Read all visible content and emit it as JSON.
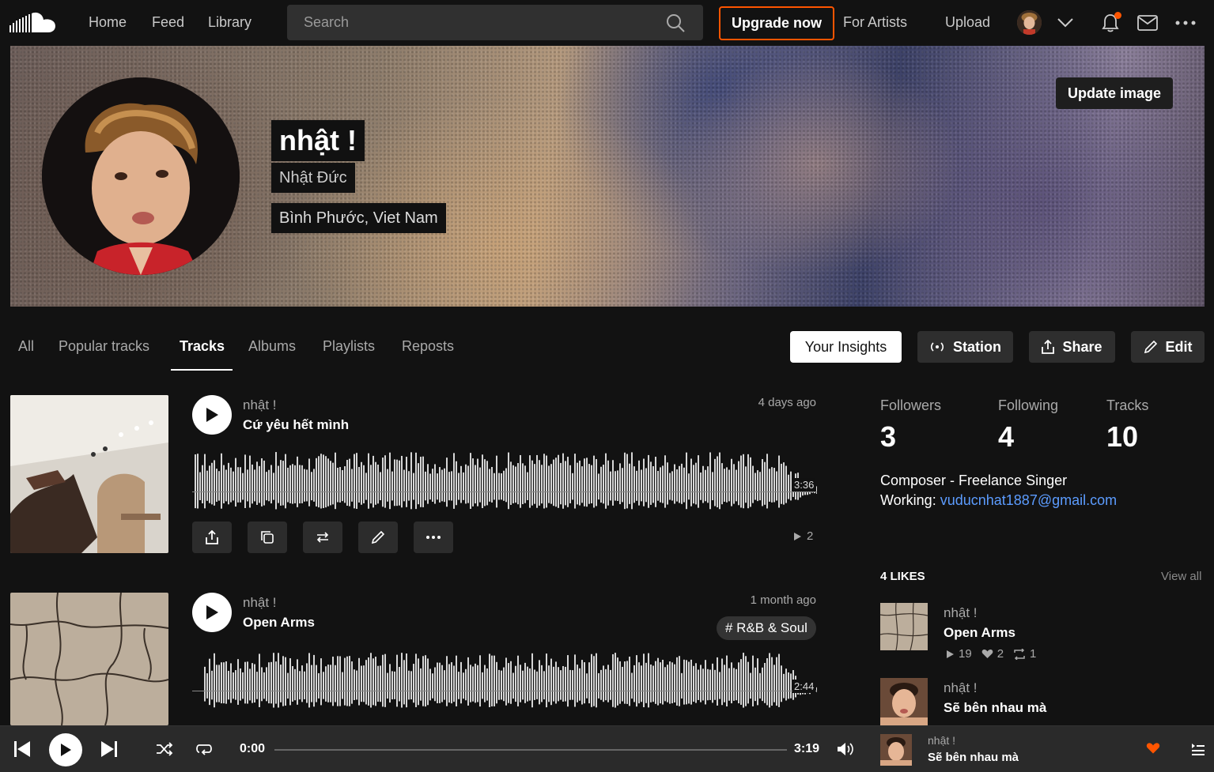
{
  "nav": {
    "links": [
      "Home",
      "Feed",
      "Library"
    ],
    "search_placeholder": "Search",
    "upgrade_label": "Upgrade now",
    "for_artists_label": "For Artists",
    "upload_label": "Upload"
  },
  "profile": {
    "display_name": "nhật !",
    "full_name": "Nhật Đức",
    "location": "Bình Phước, Viet Nam",
    "update_image_label": "Update image"
  },
  "tabs": [
    "All",
    "Popular tracks",
    "Tracks",
    "Albums",
    "Playlists",
    "Reposts"
  ],
  "active_tab": "Tracks",
  "actions": {
    "insights": "Your Insights",
    "station": "Station",
    "share": "Share",
    "edit": "Edit"
  },
  "tracks": [
    {
      "artist": "nhật !",
      "title": "Cứ yêu hết mình",
      "date": "4 days ago",
      "duration": "3:36",
      "plays": "2"
    },
    {
      "artist": "nhật !",
      "title": "Open Arms",
      "date": "1 month ago",
      "genre": "# R&B & Soul",
      "duration": "2:44"
    }
  ],
  "stats": {
    "followers_label": "Followers",
    "followers": "3",
    "following_label": "Following",
    "following": "4",
    "tracks_label": "Tracks",
    "tracks": "10"
  },
  "bio": {
    "line1": "Composer - Freelance Singer",
    "working_label": "Working:",
    "email": "vuducnhat1887@gmail.com"
  },
  "likes": {
    "heading": "4 LIKES",
    "view_all": "View all",
    "items": [
      {
        "artist": "nhật !",
        "title": "Open Arms",
        "plays": "19",
        "likes": "2",
        "reposts": "1"
      },
      {
        "artist": "nhật !",
        "title": "Sẽ bên nhau mà"
      }
    ]
  },
  "player": {
    "elapsed": "0:00",
    "total": "3:19",
    "artist": "nhật !",
    "title": "Sẽ bên nhau mà",
    "progress": 0
  },
  "colors": {
    "accent": "#ff5500",
    "link": "#5c9cff"
  }
}
